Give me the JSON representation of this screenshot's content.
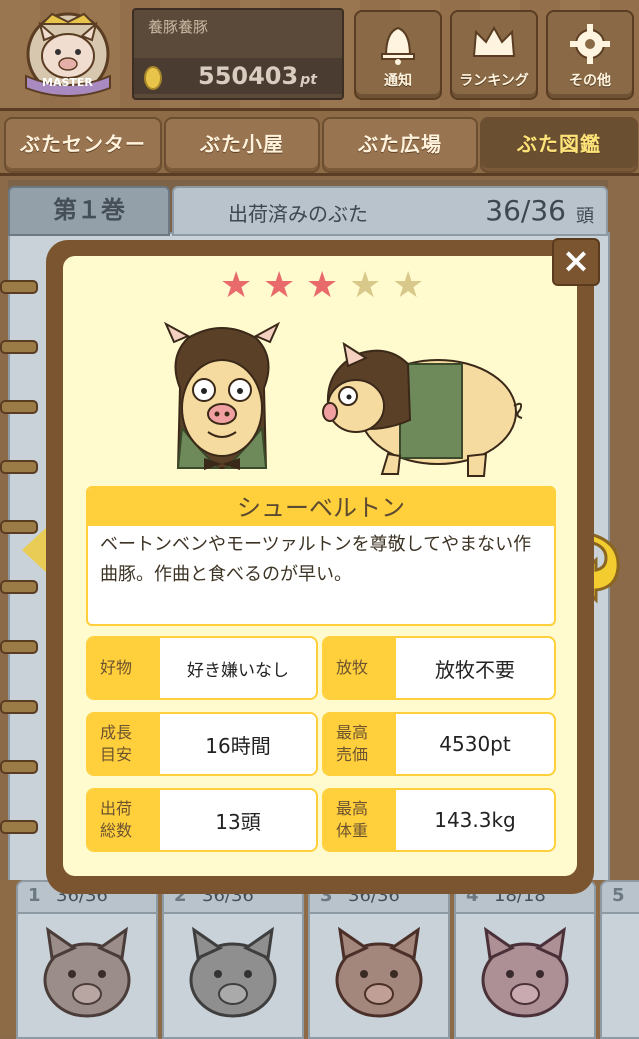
{
  "header": {
    "badge_text": "MASTER",
    "player_name": "養豚養豚",
    "points_value": "550403",
    "points_unit": "pt",
    "buttons": [
      {
        "label": "通知",
        "icon": "bell-icon"
      },
      {
        "label": "ランキング",
        "icon": "crown-icon"
      },
      {
        "label": "その他",
        "icon": "gear-icon"
      }
    ]
  },
  "tabs": [
    {
      "label": "ぶたセンター",
      "active": false
    },
    {
      "label": "ぶた小屋",
      "active": false
    },
    {
      "label": "ぶた広場",
      "active": false
    },
    {
      "label": "ぶた図鑑",
      "active": true
    }
  ],
  "book": {
    "volume_label": "第１巻",
    "shipped_label": "出荷済みのぶた",
    "shipped_count": "36/36",
    "shipped_unit": "頭"
  },
  "volumes": [
    {
      "num": "1",
      "count": "36/36"
    },
    {
      "num": "2",
      "count": "36/36"
    },
    {
      "num": "3",
      "count": "36/36"
    },
    {
      "num": "4",
      "count": "18/18"
    },
    {
      "num": "5",
      "count": ""
    }
  ],
  "modal": {
    "close_label": "×",
    "rarity": 3,
    "rarity_max": 5,
    "pig_name": "シューベルトン",
    "description": "ベートンベンやモーツァルトンを尊敬してやまない作曲豚。作曲と食べるのが早い。",
    "stats": [
      {
        "label": "好物",
        "value": "好き嫌いなし"
      },
      {
        "label": "放牧",
        "value": "放牧不要"
      },
      {
        "label": "成長\n目安",
        "value": "16時間"
      },
      {
        "label": "最高\n売価",
        "value": "4530pt"
      },
      {
        "label": "出荷\n総数",
        "value": "13頭"
      },
      {
        "label": "最高\n体重",
        "value": "143.3kg"
      }
    ]
  },
  "colors": {
    "accent_yellow": "#ffcf3c",
    "star_on": "#e86a6a",
    "star_off": "#d8c98a",
    "modal_frame": "#7a5530",
    "modal_bg": "#fffbcf"
  }
}
